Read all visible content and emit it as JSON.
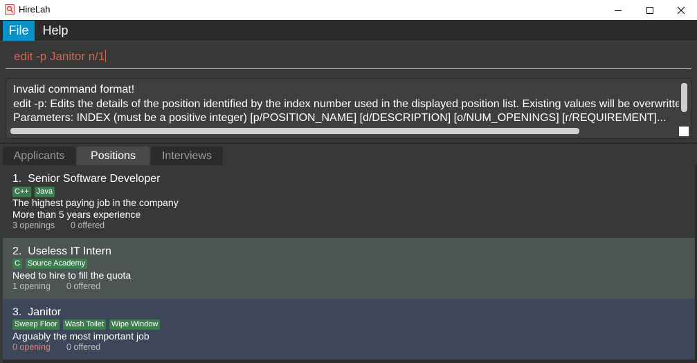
{
  "window": {
    "title": "HireLah",
    "icon": "hirelah-app-icon"
  },
  "menu": {
    "file_label": "File",
    "help_label": "Help"
  },
  "command": {
    "value": "edit -p Janitor n/1"
  },
  "result": {
    "lines": [
      "Invalid command format!",
      "edit -p: Edits the details of the position identified by the index number used in the displayed position list. Existing values will be overwritte",
      "Parameters: INDEX (must be a positive integer) [p/POSITION_NAME] [d/DESCRIPTION] [o/NUM_OPENINGS] [r/REQUIREMENT]..."
    ]
  },
  "tabs": {
    "applicants": "Applicants",
    "positions": "Positions",
    "interviews": "Interviews",
    "selected": "Positions"
  },
  "positions": [
    {
      "index": "1.",
      "name": "Senior Software Developer",
      "tags": [
        "C++",
        "Java"
      ],
      "requirements": [
        "The highest paying job in the company",
        "More than 5 years experience"
      ],
      "openings": "3 openings",
      "offered": "0 offered"
    },
    {
      "index": "2.",
      "name": "Useless IT Intern",
      "tags": [
        "C",
        "Source Academy"
      ],
      "requirements": [
        "Need to hire to fill the quota"
      ],
      "openings": "1 opening",
      "offered": "0 offered"
    },
    {
      "index": "3.",
      "name": "Janitor",
      "tags": [
        "Sweep Floor",
        "Wash Toilet",
        "Wipe Window"
      ],
      "requirements": [
        "Arguably the most important job"
      ],
      "openings": "0 opening",
      "offered": "0 offered"
    }
  ],
  "colors": {
    "accent": "#0a91c8",
    "tag": "#3e7b4f",
    "command_text": "#d06651",
    "warning": "#e87b7b",
    "selected_card": "#3e4759"
  }
}
